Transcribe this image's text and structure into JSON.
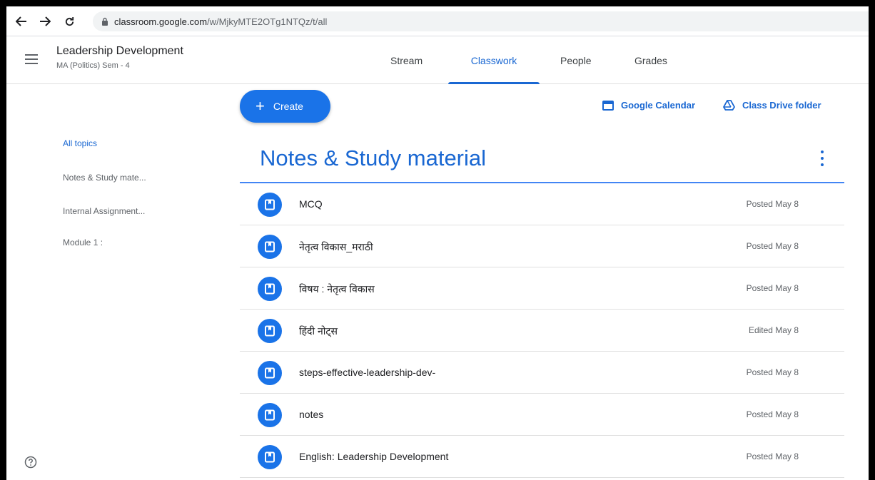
{
  "browser": {
    "back_icon": "arrow-left-icon",
    "forward_icon": "arrow-right-icon",
    "reload_icon": "reload-icon",
    "url_host": "classroom.google.com",
    "url_path": "/w/MjkyMTE2OTg1NTQz/t/all"
  },
  "header": {
    "class_name": "Leadership Development",
    "class_section": "MA (Politics) Sem - 4",
    "tabs": [
      {
        "label": "Stream",
        "active": false
      },
      {
        "label": "Classwork",
        "active": true
      },
      {
        "label": "People",
        "active": false
      },
      {
        "label": "Grades",
        "active": false
      }
    ]
  },
  "sidebar": {
    "items": [
      {
        "label": "All topics",
        "active": true
      },
      {
        "label": "Notes & Study mate..."
      },
      {
        "label": "Internal Assignment..."
      },
      {
        "label": "Module 1 :"
      }
    ]
  },
  "toolbar": {
    "create_label": "Create",
    "calendar_label": "Google Calendar",
    "drive_label": "Class Drive folder"
  },
  "topic": {
    "title": "Notes & Study material",
    "items": [
      {
        "label": "MCQ",
        "status": "Posted May 8"
      },
      {
        "label": "नेतृत्व विकास_मराठी",
        "status": "Posted May 8"
      },
      {
        "label": "विषय : नेतृत्व विकास",
        "status": "Posted May 8"
      },
      {
        "label": "हिंदी नोट्स",
        "status": "Edited May 8"
      },
      {
        "label": "steps-effective-leadership-dev-",
        "status": "Posted May 8"
      },
      {
        "label": "notes",
        "status": "Posted May 8"
      },
      {
        "label": "English: Leadership Development",
        "status": "Posted May 8"
      }
    ]
  },
  "colors": {
    "accent": "#1967d2",
    "button": "#1a73e8",
    "frame": "#000000"
  }
}
